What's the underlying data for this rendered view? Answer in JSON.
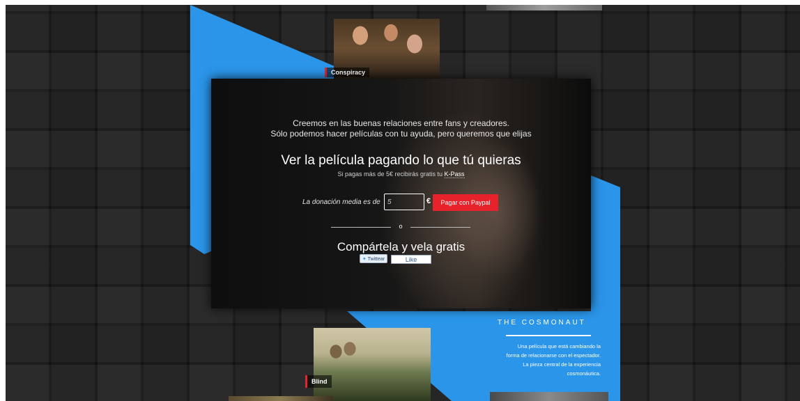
{
  "thumbnails": {
    "conspiracy_label": "Conspiracy",
    "blind_label": "Blind"
  },
  "modal": {
    "intro_line1": "Creemos en las buenas relaciones entre fans y creadores.",
    "intro_line2": "Sólo podemos hacer películas con tu ayuda, pero queremos que elijas",
    "headline": "Ver la película pagando lo que tú quieras",
    "subline_prefix": "Si pagas más de 5€ recibirás gratis tu ",
    "subline_link": "K-Pass",
    "donation_label": "La donación media es de",
    "donation_value": "5",
    "currency": "€",
    "paypal_button": "Pagar con Paypal",
    "divider_text": "o",
    "share_title": "Compártela y vela gratis",
    "tweet_button": "Twittear",
    "like_button": "Like"
  },
  "cosmonaut": {
    "title": "THE COSMONAUT",
    "description_lines": [
      "Una película que está cambiando la",
      "forma de relacionarse con el espectador.",
      "La pieza central de la experiencia",
      "cosmonáutica."
    ]
  },
  "colors": {
    "accent_blue": "#2b95e9",
    "button_red": "#e8222a",
    "background_dark": "#1c1c1c"
  },
  "icons": {
    "twitter": "twitter-bird-icon"
  }
}
